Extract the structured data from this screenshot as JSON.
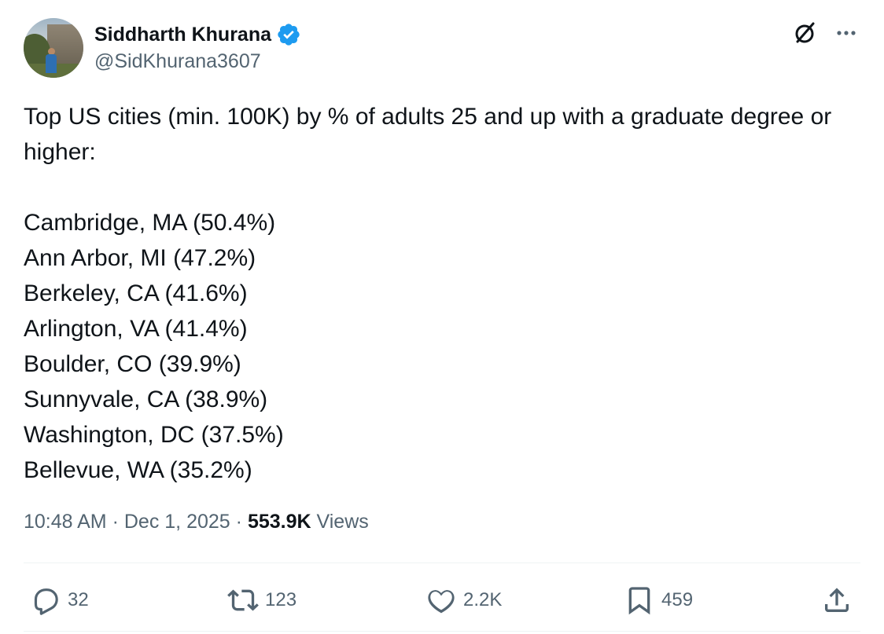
{
  "author": {
    "display_name": "Siddharth Khurana",
    "handle": "@SidKhurana3607",
    "verified": true,
    "verified_color": "#1d9bf0"
  },
  "tweet": {
    "intro": "Top US cities (min. 100K) by % of adults 25 and up with a graduate degree or higher:",
    "cities": [
      "Cambridge, MA (50.4%)",
      "Ann Arbor, MI (47.2%)",
      "Berkeley, CA (41.6%)",
      "Arlington, VA (41.4%)",
      "Boulder, CO (39.9%)",
      "Sunnyvale, CA (38.9%)",
      "Washington, DC (37.5%)",
      "Bellevue, WA (35.2%)"
    ]
  },
  "meta": {
    "time": "10:48 AM",
    "date": "Dec 1, 2025",
    "separator": "·",
    "views_count": "553.9K",
    "views_label": "Views"
  },
  "actions": {
    "replies": "32",
    "reposts": "123",
    "likes": "2.2K",
    "bookmarks": "459"
  },
  "icons": {
    "header": [
      "grok-icon",
      "more-icon"
    ],
    "actions": [
      "reply-icon",
      "repost-icon",
      "like-icon",
      "bookmark-icon",
      "share-icon"
    ]
  },
  "colors": {
    "text_primary": "#0f1419",
    "text_secondary": "#536471",
    "divider": "#eff3f4"
  }
}
